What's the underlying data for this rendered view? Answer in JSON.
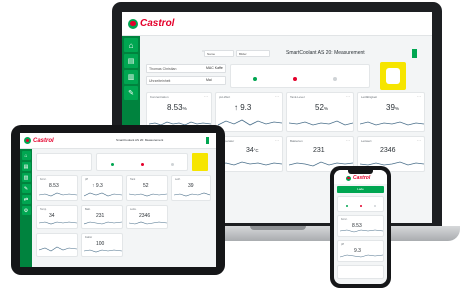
{
  "brand": {
    "name": "Castrol"
  },
  "colors": {
    "brand_green": "#00a651",
    "nav_green": "#00833e",
    "brand_red": "#e4002b",
    "chart_line": "#4a6f8a"
  },
  "laptop": {
    "window_title": "SmartCoolant AS 20: Measurement",
    "header_field": "Name",
    "header_value": "Bilder",
    "field_row1": "Thomas Christian",
    "field_row2": "Uhrzeiteinheit",
    "field_row1_value": "MAC Kaffe",
    "field_row2_value": "Mai",
    "tiles": [
      {
        "label": "Konzentration",
        "value": "8.53",
        "unit": "%",
        "icon": "dots-icon"
      },
      {
        "label": "pH-Wert",
        "value": "↑ 9.3",
        "unit": "",
        "icon": "dots-icon"
      },
      {
        "label": "Tank-Level",
        "value": "52",
        "unit": "%",
        "icon": "dots-icon"
      },
      {
        "label": "Leitfähigkeit",
        "value": "39",
        "unit": "%",
        "icon": "dots-icon"
      },
      {
        "label": "Temperatur",
        "value": "34",
        "unit": "°C",
        "icon": "dots-icon"
      },
      {
        "label": "Bakterien",
        "value": "231",
        "unit": "",
        "icon": "dots-icon"
      },
      {
        "label": "Leitwert",
        "value": "2346",
        "unit": "",
        "icon": "dots-icon"
      },
      {
        "label": "Pfl. Faktor",
        "value": "100",
        "unit": "%",
        "icon": "dots-icon"
      }
    ]
  },
  "tablet": {
    "window_title": "SmartCoolant AS 20: Measurement",
    "tiles": [
      {
        "label": "Konz.",
        "value": "8.53"
      },
      {
        "label": "pH",
        "value": "↑ 9.3"
      },
      {
        "label": "Tank",
        "value": "52"
      },
      {
        "label": "Leitf.",
        "value": "39"
      },
      {
        "label": "Temp.",
        "value": "34"
      },
      {
        "label": "Bakt.",
        "value": "231"
      },
      {
        "label": "Leitw.",
        "value": "2346"
      },
      {
        "label": "Faktor",
        "value": "100"
      }
    ]
  },
  "phone": {
    "header": "Castrol",
    "button": "Lade",
    "tiles": [
      {
        "label": "Konz.",
        "value": "8.53"
      },
      {
        "label": "pH",
        "value": "9.3"
      }
    ]
  }
}
